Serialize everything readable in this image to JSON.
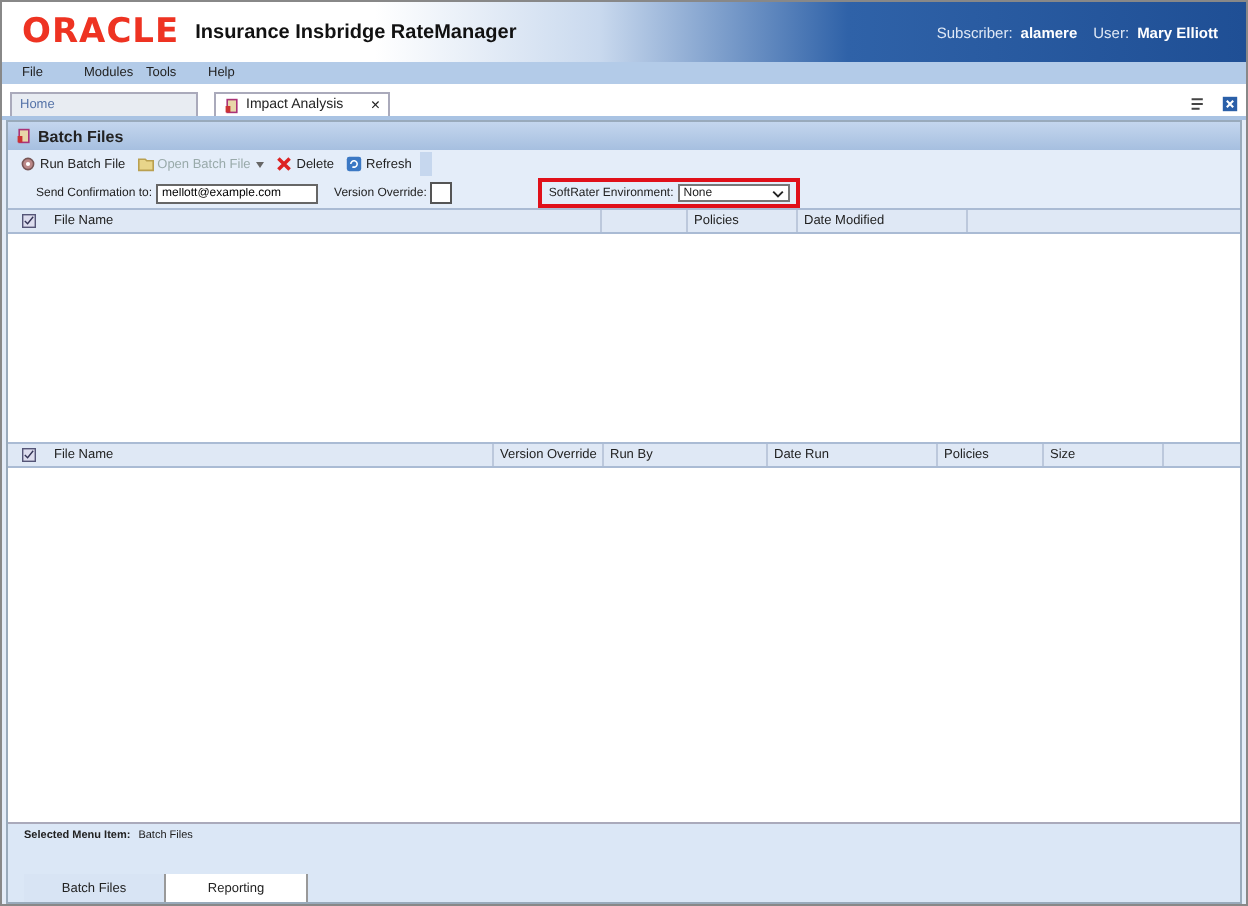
{
  "header": {
    "logo": "ORACLE",
    "app_title": "Insurance Insbridge RateManager",
    "subscriber_label": "Subscriber:",
    "subscriber": "alamere",
    "user_label": "User:",
    "user": "Mary Elliott"
  },
  "menu": [
    "File",
    "Modules",
    "Tools",
    "Help"
  ],
  "tabs": [
    {
      "label": "Home",
      "selected": false
    },
    {
      "label": "Impact Analysis",
      "selected": true,
      "close": "×"
    }
  ],
  "panel_title": "Batch Files",
  "toolbar": [
    {
      "kind": "run",
      "label": "Run Batch File",
      "disabled": false
    },
    {
      "kind": "open",
      "label": "Open Batch File",
      "disabled": true
    },
    {
      "kind": "delete",
      "label": "Delete",
      "disabled": false
    },
    {
      "kind": "refresh",
      "label": "Refresh",
      "disabled": false
    }
  ],
  "form": {
    "send_confirmation": {
      "label": "Send Confirmation to:",
      "value": "mellott@example.com"
    },
    "version_override": {
      "label": "Version Override:",
      "checked": false
    },
    "softrater_environment": {
      "label": "SoftRater Environment:",
      "value": "None",
      "highlighted": true
    }
  },
  "batch_table": {
    "columns": [
      "File Name",
      "Policies",
      "Date Modified"
    ]
  },
  "results_table": {
    "columns": [
      "File Name",
      "Version Override",
      "Run By",
      "Date Run",
      "Policies",
      "Size"
    ]
  },
  "status": {
    "label": "Selected Menu Item:",
    "value": "Batch Files"
  },
  "bottom_tabs": [
    {
      "label": "Batch Files",
      "selected": true
    },
    {
      "label": "Reporting",
      "selected": false
    }
  ]
}
